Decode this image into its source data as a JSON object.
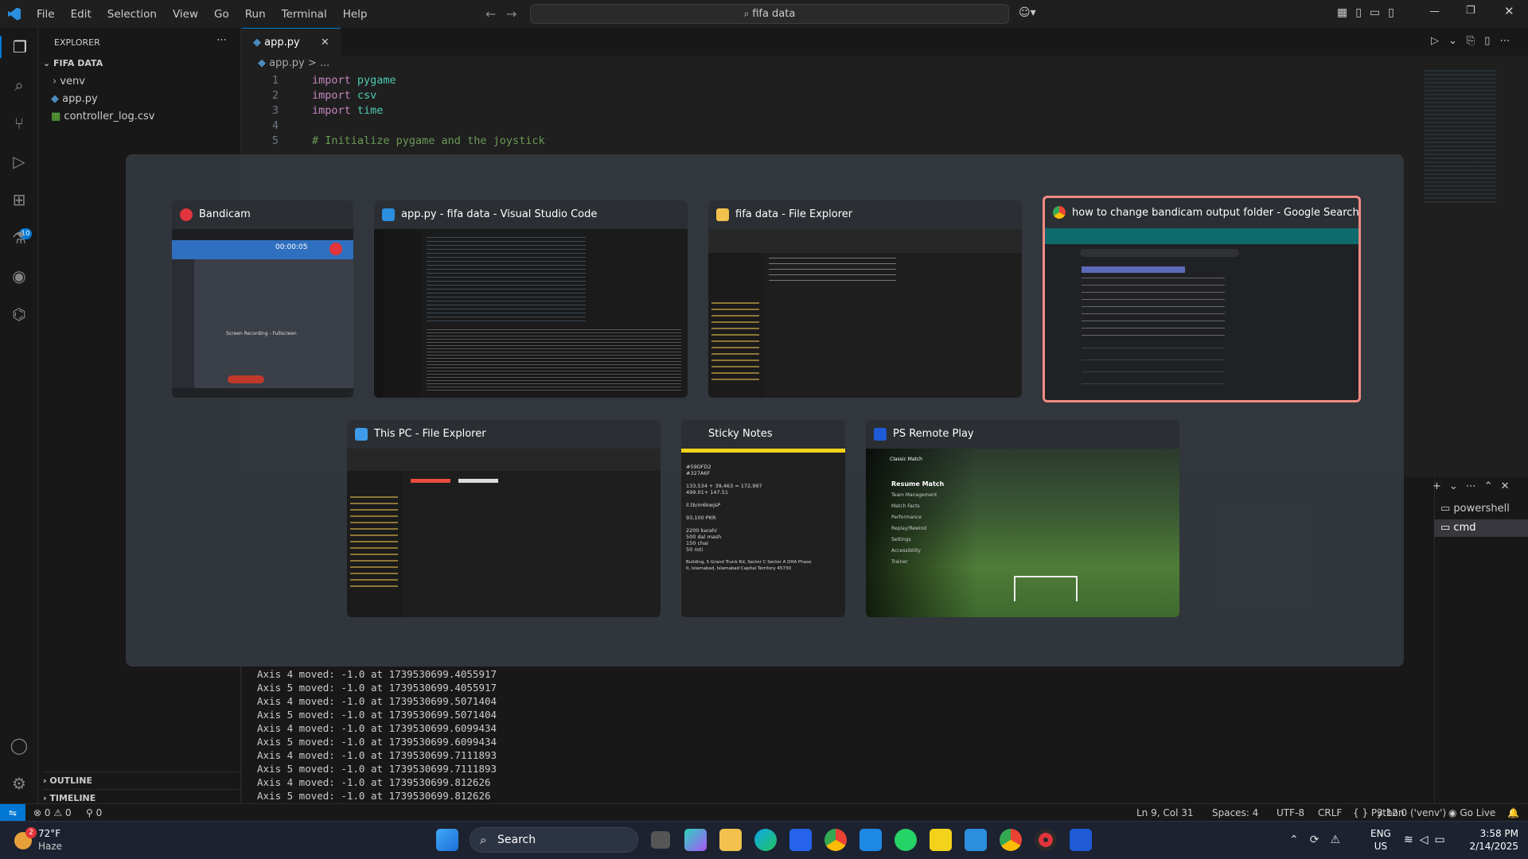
{
  "menu": [
    "File",
    "Edit",
    "Selection",
    "View",
    "Go",
    "Run",
    "Terminal",
    "Help"
  ],
  "command_center": "fifa data",
  "explorer": {
    "title": "EXPLORER",
    "folder": "FIFA DATA",
    "items": [
      "venv",
      "app.py",
      "controller_log.csv"
    ],
    "outline": "OUTLINE",
    "timeline": "TIMELINE"
  },
  "editor": {
    "tab": "app.py",
    "breadcrumb": "app.py > ...",
    "lines": [
      {
        "n": "1",
        "kw": "import",
        "rest": " pygame"
      },
      {
        "n": "2",
        "kw": "import",
        "rest": " csv"
      },
      {
        "n": "3",
        "kw": "import",
        "rest": " time"
      },
      {
        "n": "4",
        "kw": "",
        "rest": ""
      },
      {
        "n": "5",
        "kw": "",
        "rest": "# Initialize pygame and the joystick"
      }
    ]
  },
  "terminal": {
    "lines": [
      "Axis 4 moved: -1.0 at 1739530699.4055917",
      "Axis 5 moved: -1.0 at 1739530699.4055917",
      "Axis 4 moved: -1.0 at 1739530699.5071404",
      "Axis 5 moved: -1.0 at 1739530699.5071404",
      "Axis 4 moved: -1.0 at 1739530699.6099434",
      "Axis 5 moved: -1.0 at 1739530699.6099434",
      "Axis 4 moved: -1.0 at 1739530699.7111893",
      "Axis 5 moved: -1.0 at 1739530699.7111893",
      "Axis 4 moved: -1.0 at 1739530699.812626",
      "Axis 5 moved: -1.0 at 1739530699.812626"
    ],
    "shells": [
      "powershell",
      "cmd"
    ]
  },
  "task_switcher": {
    "windows": [
      {
        "title": "Bandicam",
        "color": "#e2343c"
      },
      {
        "title": "app.py - fifa data - Visual Studio Code",
        "color": "#2b8ede"
      },
      {
        "title": "fifa data - File Explorer",
        "color": "#f2c14e"
      },
      {
        "title": "how to change bandicam output folder - Google Search - Goo...",
        "color": "#4caf50"
      },
      {
        "title": "This PC - File Explorer",
        "color": "#3d9be9"
      },
      {
        "title": "Sticky Notes",
        "color": "#f3d21c"
      },
      {
        "title": "PS Remote Play",
        "color": "#1f5bd6"
      }
    ],
    "sticky_notes_text": [
      "#59DFD2",
      "#327A6F",
      "",
      "133,534 + 39,463 = 172,997",
      "499.01+ 147.51",
      "",
      "il.tb/m6kwjsP",
      "",
      "93,100 PKR",
      "",
      "2200 karahi",
      "500 dal mash",
      "150 chai",
      "50 roti",
      "",
      "Building, 5 Grand Trunk Rd, Sector C Sector A DHA Phase",
      "II, Islamabad, Islamabad Capital Territory 45730"
    ],
    "ps_menu": [
      "Resume Match",
      "Team Management",
      "Match Facts",
      "Performance",
      "Replay/Rewind",
      "Settings",
      "Accessibility",
      "Trainer"
    ],
    "ps_header": "Classic Match",
    "bandicam_timer": "00:00:05",
    "bandicam_heading": "Screen Recording - Fullscreen"
  },
  "status": {
    "errors": "0",
    "warnings": "0",
    "ports": "0",
    "position": "Ln 9, Col 31",
    "spaces": "Spaces: 4",
    "encoding": "UTF-8",
    "eol": "CRLF",
    "language": "Python",
    "interpreter": "3.12.0 ('venv')",
    "golive": "Go Live"
  },
  "taskbar": {
    "weather_temp": "72°F",
    "weather_desc": "Haze",
    "weather_badge": "2",
    "search": "Search",
    "lang1": "ENG",
    "lang2": "US",
    "time": "3:58 PM",
    "date": "2/14/2025"
  }
}
